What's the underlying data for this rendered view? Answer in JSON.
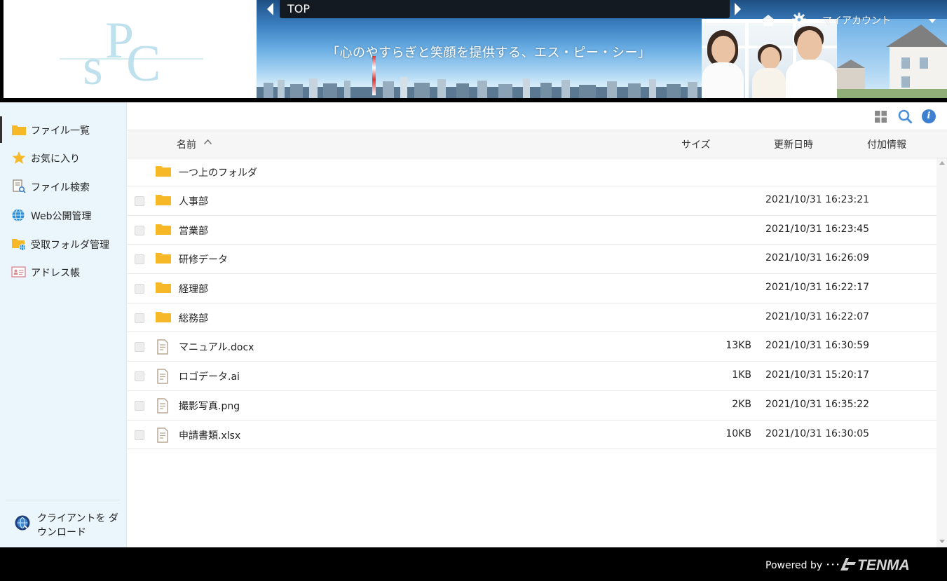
{
  "header": {
    "logo_text": "SPC",
    "breadcrumb": "TOP",
    "tagline": "「心のやすらぎと笑顔を提供する、エス・ピー・シー」",
    "account_label": "マイアカウント"
  },
  "sidebar": {
    "items": [
      {
        "label": "ファイル一覧",
        "icon": "folder-icon",
        "active": true
      },
      {
        "label": "お気に入り",
        "icon": "star-icon"
      },
      {
        "label": "ファイル検索",
        "icon": "file-search-icon"
      },
      {
        "label": "Web公開管理",
        "icon": "globe-icon"
      },
      {
        "label": "受取フォルダ管理",
        "icon": "folder-globe-icon"
      },
      {
        "label": "アドレス帳",
        "icon": "address-card-icon"
      }
    ],
    "client_download": "クライアントを ダウンロード"
  },
  "table": {
    "headers": {
      "name": "名前",
      "size": "サイズ",
      "modified": "更新日時",
      "extra": "付加情報"
    },
    "parent_folder": "一つ上のフォルダ",
    "rows": [
      {
        "name": "人事部",
        "type": "folder",
        "size": "",
        "modified": "2021/10/31 16:23:21"
      },
      {
        "name": "営業部",
        "type": "folder",
        "size": "",
        "modified": "2021/10/31 16:23:45"
      },
      {
        "name": "研修データ",
        "type": "folder",
        "size": "",
        "modified": "2021/10/31 16:26:09"
      },
      {
        "name": "経理部",
        "type": "folder",
        "size": "",
        "modified": "2021/10/31 16:22:17"
      },
      {
        "name": "総務部",
        "type": "folder",
        "size": "",
        "modified": "2021/10/31 16:22:07"
      },
      {
        "name": "マニュアル.docx",
        "type": "file",
        "size": "13KB",
        "modified": "2021/10/31 16:30:59"
      },
      {
        "name": "ロゴデータ.ai",
        "type": "file",
        "size": "1KB",
        "modified": "2021/10/31 15:20:17"
      },
      {
        "name": "撮影写真.png",
        "type": "file",
        "size": "2KB",
        "modified": "2021/10/31 16:35:22"
      },
      {
        "name": "申請書類.xlsx",
        "type": "file",
        "size": "10KB",
        "modified": "2021/10/31 16:30:05"
      }
    ]
  },
  "footer": {
    "powered_by": "Powered by ･･･",
    "brand": "TENMA"
  },
  "colors": {
    "sidebar_bg": "#eaf6fb",
    "folder": "#f6b826",
    "info_blue": "#3d7fd1",
    "logo_blue": "#bfe1ee"
  }
}
